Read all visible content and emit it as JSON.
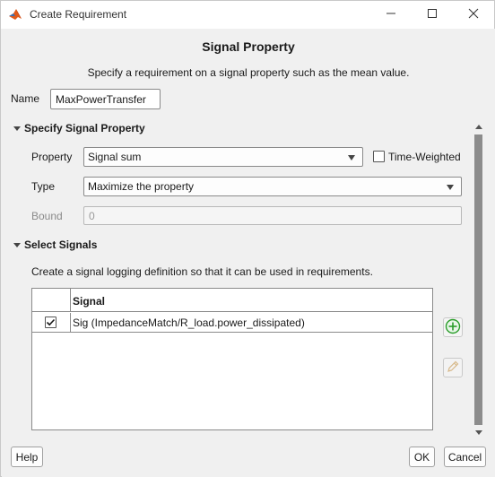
{
  "window": {
    "title": "Create Requirement",
    "icons": {
      "app": "matlab-logo-icon",
      "minimize": "minimize-icon",
      "maximize": "maximize-icon",
      "close": "close-icon"
    }
  },
  "dialog": {
    "heading": "Signal Property",
    "description": "Specify a requirement on a signal property such as the mean value.",
    "name_label": "Name",
    "name_value": "MaxPowerTransfer"
  },
  "specify_section": {
    "title": "Specify Signal Property",
    "property_label": "Property",
    "property_value": "Signal sum",
    "time_weighted_label": "Time-Weighted",
    "time_weighted_checked": false,
    "type_label": "Type",
    "type_value": "Maximize the property",
    "bound_label": "Bound",
    "bound_value": "0"
  },
  "signals_section": {
    "title": "Select Signals",
    "description": "Create a signal logging definition so that it can be used in requirements.",
    "table": {
      "column_signal": "Signal",
      "rows": [
        {
          "checked": true,
          "signal": "Sig (ImpedanceMatch/R_load.power_dissipated)"
        }
      ]
    },
    "add_icon": "add-icon",
    "edit_icon": "pencil-icon"
  },
  "footer": {
    "help_label": "Help",
    "ok_label": "OK",
    "cancel_label": "Cancel"
  },
  "colors": {
    "add_green": "#2a9d2a",
    "window_bg": "#f0f0f0"
  }
}
